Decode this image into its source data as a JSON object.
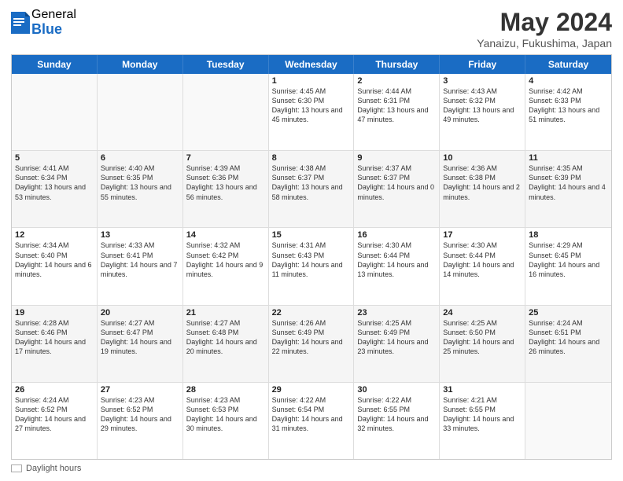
{
  "logo": {
    "general": "General",
    "blue": "Blue"
  },
  "title": "May 2024",
  "location": "Yanaizu, Fukushima, Japan",
  "days_of_week": [
    "Sunday",
    "Monday",
    "Tuesday",
    "Wednesday",
    "Thursday",
    "Friday",
    "Saturday"
  ],
  "footer_label": "Daylight hours",
  "weeks": [
    [
      {
        "day": "",
        "info": ""
      },
      {
        "day": "",
        "info": ""
      },
      {
        "day": "",
        "info": ""
      },
      {
        "day": "1",
        "info": "Sunrise: 4:45 AM\nSunset: 6:30 PM\nDaylight: 13 hours\nand 45 minutes."
      },
      {
        "day": "2",
        "info": "Sunrise: 4:44 AM\nSunset: 6:31 PM\nDaylight: 13 hours\nand 47 minutes."
      },
      {
        "day": "3",
        "info": "Sunrise: 4:43 AM\nSunset: 6:32 PM\nDaylight: 13 hours\nand 49 minutes."
      },
      {
        "day": "4",
        "info": "Sunrise: 4:42 AM\nSunset: 6:33 PM\nDaylight: 13 hours\nand 51 minutes."
      }
    ],
    [
      {
        "day": "5",
        "info": "Sunrise: 4:41 AM\nSunset: 6:34 PM\nDaylight: 13 hours\nand 53 minutes."
      },
      {
        "day": "6",
        "info": "Sunrise: 4:40 AM\nSunset: 6:35 PM\nDaylight: 13 hours\nand 55 minutes."
      },
      {
        "day": "7",
        "info": "Sunrise: 4:39 AM\nSunset: 6:36 PM\nDaylight: 13 hours\nand 56 minutes."
      },
      {
        "day": "8",
        "info": "Sunrise: 4:38 AM\nSunset: 6:37 PM\nDaylight: 13 hours\nand 58 minutes."
      },
      {
        "day": "9",
        "info": "Sunrise: 4:37 AM\nSunset: 6:37 PM\nDaylight: 14 hours\nand 0 minutes."
      },
      {
        "day": "10",
        "info": "Sunrise: 4:36 AM\nSunset: 6:38 PM\nDaylight: 14 hours\nand 2 minutes."
      },
      {
        "day": "11",
        "info": "Sunrise: 4:35 AM\nSunset: 6:39 PM\nDaylight: 14 hours\nand 4 minutes."
      }
    ],
    [
      {
        "day": "12",
        "info": "Sunrise: 4:34 AM\nSunset: 6:40 PM\nDaylight: 14 hours\nand 6 minutes."
      },
      {
        "day": "13",
        "info": "Sunrise: 4:33 AM\nSunset: 6:41 PM\nDaylight: 14 hours\nand 7 minutes."
      },
      {
        "day": "14",
        "info": "Sunrise: 4:32 AM\nSunset: 6:42 PM\nDaylight: 14 hours\nand 9 minutes."
      },
      {
        "day": "15",
        "info": "Sunrise: 4:31 AM\nSunset: 6:43 PM\nDaylight: 14 hours\nand 11 minutes."
      },
      {
        "day": "16",
        "info": "Sunrise: 4:30 AM\nSunset: 6:44 PM\nDaylight: 14 hours\nand 13 minutes."
      },
      {
        "day": "17",
        "info": "Sunrise: 4:30 AM\nSunset: 6:44 PM\nDaylight: 14 hours\nand 14 minutes."
      },
      {
        "day": "18",
        "info": "Sunrise: 4:29 AM\nSunset: 6:45 PM\nDaylight: 14 hours\nand 16 minutes."
      }
    ],
    [
      {
        "day": "19",
        "info": "Sunrise: 4:28 AM\nSunset: 6:46 PM\nDaylight: 14 hours\nand 17 minutes."
      },
      {
        "day": "20",
        "info": "Sunrise: 4:27 AM\nSunset: 6:47 PM\nDaylight: 14 hours\nand 19 minutes."
      },
      {
        "day": "21",
        "info": "Sunrise: 4:27 AM\nSunset: 6:48 PM\nDaylight: 14 hours\nand 20 minutes."
      },
      {
        "day": "22",
        "info": "Sunrise: 4:26 AM\nSunset: 6:49 PM\nDaylight: 14 hours\nand 22 minutes."
      },
      {
        "day": "23",
        "info": "Sunrise: 4:25 AM\nSunset: 6:49 PM\nDaylight: 14 hours\nand 23 minutes."
      },
      {
        "day": "24",
        "info": "Sunrise: 4:25 AM\nSunset: 6:50 PM\nDaylight: 14 hours\nand 25 minutes."
      },
      {
        "day": "25",
        "info": "Sunrise: 4:24 AM\nSunset: 6:51 PM\nDaylight: 14 hours\nand 26 minutes."
      }
    ],
    [
      {
        "day": "26",
        "info": "Sunrise: 4:24 AM\nSunset: 6:52 PM\nDaylight: 14 hours\nand 27 minutes."
      },
      {
        "day": "27",
        "info": "Sunrise: 4:23 AM\nSunset: 6:52 PM\nDaylight: 14 hours\nand 29 minutes."
      },
      {
        "day": "28",
        "info": "Sunrise: 4:23 AM\nSunset: 6:53 PM\nDaylight: 14 hours\nand 30 minutes."
      },
      {
        "day": "29",
        "info": "Sunrise: 4:22 AM\nSunset: 6:54 PM\nDaylight: 14 hours\nand 31 minutes."
      },
      {
        "day": "30",
        "info": "Sunrise: 4:22 AM\nSunset: 6:55 PM\nDaylight: 14 hours\nand 32 minutes."
      },
      {
        "day": "31",
        "info": "Sunrise: 4:21 AM\nSunset: 6:55 PM\nDaylight: 14 hours\nand 33 minutes."
      },
      {
        "day": "",
        "info": ""
      }
    ]
  ]
}
